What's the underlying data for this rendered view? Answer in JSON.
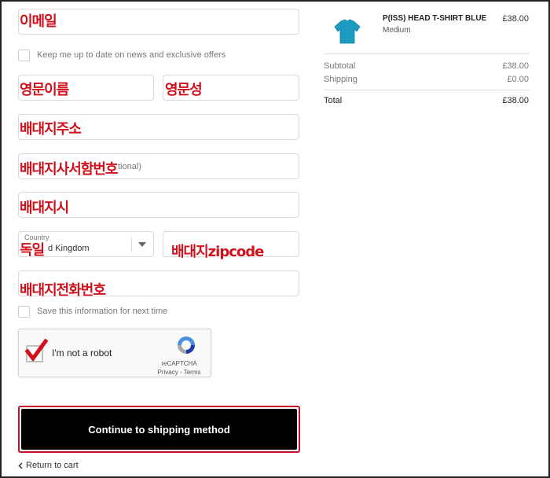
{
  "form": {
    "email": {
      "annotation": "이메일"
    },
    "newsletter": {
      "label": "Keep me up to date on news and exclusive offers"
    },
    "first_name": {
      "annotation": "영문이름"
    },
    "last_name": {
      "annotation": "영문성"
    },
    "address": {
      "annotation": "배대지주소"
    },
    "apartment": {
      "annotation": "배대지사서함번호",
      "placeholder_fragment": "tional)"
    },
    "city": {
      "annotation": "배대지시"
    },
    "country": {
      "label": "Country",
      "value": "d Kingdom",
      "annotation": "독일"
    },
    "postcode": {
      "annotation": "배대지zipcode"
    },
    "phone": {
      "annotation": "배대지전화번호"
    },
    "save_info": {
      "label": "Save this information for next time"
    }
  },
  "recaptcha": {
    "label": "I'm not a robot",
    "brand": "reCAPTCHA",
    "links": "Privacy - Terms"
  },
  "actions": {
    "continue_label": "Continue to shipping method",
    "return_label": "Return to cart"
  },
  "summary": {
    "product": {
      "name": "P(ISS) HEAD T-SHIRT BLUE",
      "variant": "Medium",
      "price": "£38.00",
      "image_color": "#1a9bbf"
    },
    "subtotal": {
      "label": "Subtotal",
      "value": "£38.00"
    },
    "shipping": {
      "label": "Shipping",
      "value": "£0.00"
    },
    "total": {
      "label": "Total",
      "value": "£38.00"
    }
  },
  "colors": {
    "annotation": "#d0101a",
    "cta_bg": "#000000",
    "cta_outline": "#c8102e",
    "check": "#d0101a"
  }
}
